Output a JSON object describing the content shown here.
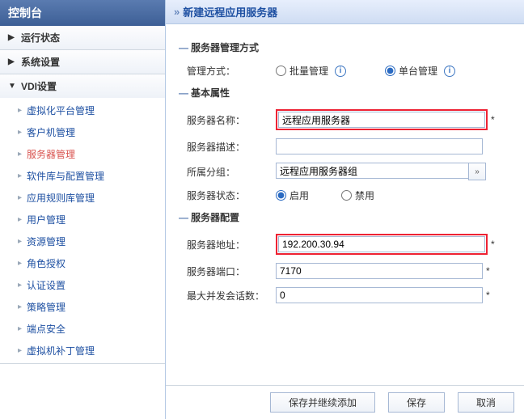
{
  "sidebar": {
    "title": "控制台",
    "sections": [
      {
        "label": "运行状态",
        "expanded": false
      },
      {
        "label": "系统设置",
        "expanded": false
      },
      {
        "label": "VDI设置",
        "expanded": true,
        "items": [
          {
            "label": "虚拟化平台管理"
          },
          {
            "label": "客户机管理"
          },
          {
            "label": "服务器管理",
            "active": true
          },
          {
            "label": "软件库与配置管理"
          },
          {
            "label": "应用规则库管理"
          },
          {
            "label": "用户管理"
          },
          {
            "label": "资源管理"
          },
          {
            "label": "角色授权"
          },
          {
            "label": "认证设置"
          },
          {
            "label": "策略管理"
          },
          {
            "label": "端点安全"
          },
          {
            "label": "虚拟机补丁管理"
          }
        ]
      }
    ]
  },
  "header": {
    "title": "新建远程应用服务器"
  },
  "sections": {
    "mgmt": {
      "title": "服务器管理方式",
      "method_label": "管理方式：",
      "batch": "批量管理",
      "single": "单台管理",
      "selected": "single"
    },
    "basic": {
      "title": "基本属性",
      "name_label": "服务器名称：",
      "name_value": "远程应用服务器",
      "desc_label": "服务器描述：",
      "desc_value": "",
      "group_label": "所属分组：",
      "group_value": "远程应用服务器组",
      "status_label": "服务器状态：",
      "enable": "启用",
      "disable": "禁用",
      "status_selected": "enable"
    },
    "config": {
      "title": "服务器配置",
      "addr_label": "服务器地址：",
      "addr_value": "192.200.30.94",
      "port_label": "服务器端口：",
      "port_value": "7170",
      "sessions_label": "最大并发会话数：",
      "sessions_value": "0"
    }
  },
  "footer": {
    "save_continue": "保存并继续添加",
    "save": "保存",
    "cancel": "取消"
  },
  "asterisk": "*"
}
